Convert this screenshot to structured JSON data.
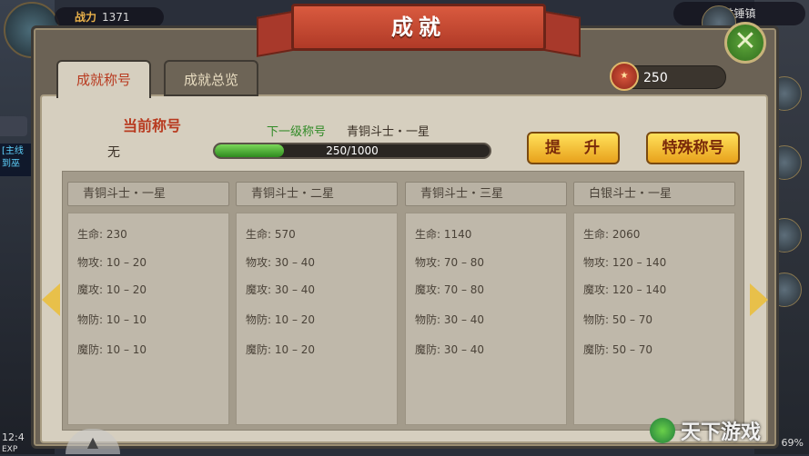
{
  "hud": {
    "power_label": "战力",
    "power_value": "1371",
    "town": "铁锤镇",
    "time": "12:4",
    "exp": "EXP",
    "battery": "69%",
    "quest": "[主线\n到巫"
  },
  "window": {
    "title": "成就",
    "close": "✕"
  },
  "tabs": [
    {
      "label": "成就称号",
      "active": true
    },
    {
      "label": "成就总览",
      "active": false
    }
  ],
  "currency": {
    "value": "250",
    "icon": "medal-icon"
  },
  "current_title": {
    "label": "当前称号",
    "value": "无"
  },
  "next_title": {
    "label": "下一级称号",
    "value": "青铜斗士・一星"
  },
  "progress": {
    "text": "250/1000",
    "fraction": 0.25
  },
  "buttons": {
    "promote": "提 升",
    "special": "特殊称号"
  },
  "cards": [
    {
      "name": "青铜斗士・一星",
      "stats": [
        "生命: 230",
        "物攻: 10 – 20",
        "魔攻: 10 – 20",
        "物防: 10 – 10",
        "魔防: 10 – 10"
      ]
    },
    {
      "name": "青铜斗士・二星",
      "stats": [
        "生命: 570",
        "物攻: 30 – 40",
        "魔攻: 30 – 40",
        "物防: 10 – 20",
        "魔防: 10 – 20"
      ]
    },
    {
      "name": "青铜斗士・三星",
      "stats": [
        "生命: 1140",
        "物攻: 70 – 80",
        "魔攻: 70 – 80",
        "物防: 30 – 40",
        "魔防: 30 – 40"
      ]
    },
    {
      "name": "白银斗士・一星",
      "stats": [
        "生命: 2060",
        "物攻: 120 – 140",
        "魔攻: 120 – 140",
        "物防: 50 – 70",
        "魔防: 50 – 70"
      ]
    }
  ],
  "watermark": "天下游戏"
}
